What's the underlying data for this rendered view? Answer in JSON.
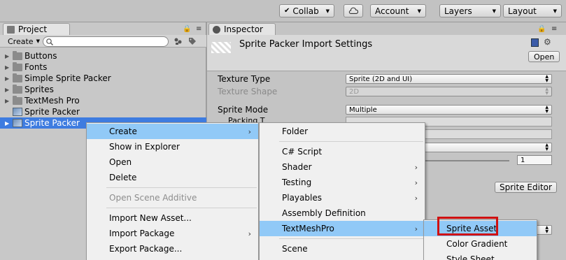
{
  "toolbar": {
    "collab_label": "Collab",
    "account_label": "Account",
    "layers_label": "Layers",
    "layout_label": "Layout",
    "check_glyph": "✔",
    "cloud_icon": "cloud-icon",
    "dropdown_glyph": "▼"
  },
  "project": {
    "tab_label": "Project",
    "create_label": "Create",
    "lock_glyph": "🔒",
    "menu_glyph": "≡",
    "dropdown_glyph": "▼",
    "tree": [
      {
        "label": "Buttons",
        "type": "folder"
      },
      {
        "label": "Fonts",
        "type": "folder"
      },
      {
        "label": "Simple Sprite Packer",
        "type": "folder"
      },
      {
        "label": "Sprites",
        "type": "folder"
      },
      {
        "label": "TextMesh Pro",
        "type": "folder"
      },
      {
        "label": "Sprite Packer",
        "type": "sprite"
      },
      {
        "label": "Sprite Packer",
        "type": "sprite",
        "selected": true
      }
    ],
    "tri_right": "▶",
    "tri_down": "▶"
  },
  "inspector": {
    "tab_label": "Inspector",
    "title": "Sprite Packer Import Settings",
    "open_label": "Open",
    "gear_glyph": "⚙",
    "texture_type_label": "Texture Type",
    "texture_type_value": "Sprite (2D and UI)",
    "texture_shape_label": "Texture Shape",
    "texture_shape_value": "2D",
    "sprite_mode_label": "Sprite Mode",
    "sprite_mode_value": "Multiple",
    "packing_tag_label": "Packing T",
    "slider_value": "1",
    "sprite_editor_label": "Sprite Editor",
    "arrows_glyph": "▲▼"
  },
  "context_menu": {
    "items": [
      {
        "label": "Create",
        "submenu": true,
        "highlighted": true
      },
      {
        "label": "Show in Explorer"
      },
      {
        "label": "Open"
      },
      {
        "label": "Delete"
      },
      {
        "label": "Open Scene Additive",
        "disabled": true
      },
      {
        "label": "Import New Asset..."
      },
      {
        "label": "Import Package",
        "submenu": true
      },
      {
        "label": "Export Package..."
      }
    ],
    "submenu_glyph": "›"
  },
  "create_menu": {
    "items": [
      {
        "label": "Folder"
      },
      {
        "label": "C# Script"
      },
      {
        "label": "Shader",
        "submenu": true
      },
      {
        "label": "Testing",
        "submenu": true
      },
      {
        "label": "Playables",
        "submenu": true
      },
      {
        "label": "Assembly Definition"
      },
      {
        "label": "TextMeshPro",
        "submenu": true,
        "highlighted": true
      },
      {
        "label": "Scene"
      }
    ]
  },
  "textmeshpro_menu": {
    "items": [
      {
        "label": "Sprite Asset",
        "highlighted": true
      },
      {
        "label": "Color Gradient"
      },
      {
        "label": "Style Sheet"
      }
    ]
  },
  "colors": {
    "selection": "#3e7ce0",
    "menu_highlight": "#91c9f7",
    "callout": "#d01010"
  }
}
